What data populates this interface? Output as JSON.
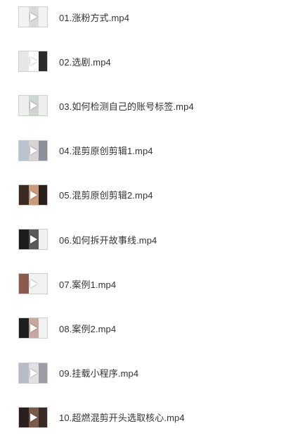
{
  "files": [
    {
      "name": "01.涨粉方式.mp4",
      "thumb_icon": "video-thumbnail-icon",
      "colors": [
        "#f2f2f2",
        "#d9d9d9",
        "#f2f2f2"
      ]
    },
    {
      "name": "02.选剧.mp4",
      "thumb_icon": "video-thumbnail-icon",
      "colors": [
        "#e6e6e6",
        "#ffffff",
        "#2b2b2b"
      ]
    },
    {
      "name": "03.如何检测自己的账号标签.mp4",
      "thumb_icon": "video-thumbnail-icon",
      "colors": [
        "#eeeeee",
        "#cfd6cf",
        "#eeeeee"
      ]
    },
    {
      "name": "04.混剪原创剪辑1.mp4",
      "thumb_icon": "video-thumbnail-icon",
      "colors": [
        "#b9c2cf",
        "#d8d2d5",
        "#8c8f99"
      ]
    },
    {
      "name": "05.混剪原创剪辑2.mp4",
      "thumb_icon": "video-thumbnail-icon",
      "colors": [
        "#3a2a22",
        "#c99a7a",
        "#2a201b"
      ]
    },
    {
      "name": "06.如何拆开故事线.mp4",
      "thumb_icon": "video-thumbnail-icon",
      "colors": [
        "#1c1c1c",
        "#5a5a5a",
        "#f0f0f0"
      ]
    },
    {
      "name": "07.案例1.mp4",
      "thumb_icon": "video-thumbnail-icon",
      "colors": [
        "#8a5a4e",
        "#f1f1f1",
        "#f1f1f1"
      ]
    },
    {
      "name": "08.案例2.mp4",
      "thumb_icon": "video-thumbnail-icon",
      "colors": [
        "#1e1e1e",
        "#c7a8a0",
        "#f1f1f1"
      ]
    },
    {
      "name": "09.挂载小程序.mp4",
      "thumb_icon": "video-thumbnail-icon",
      "colors": [
        "#b8bcc7",
        "#e3e0e4",
        "#9a9ca6"
      ]
    },
    {
      "name": "10.超燃混剪开头选取核心.mp4",
      "thumb_icon": "video-thumbnail-icon",
      "colors": [
        "#2a1f1c",
        "#7a5a48",
        "#3a2a24"
      ]
    }
  ]
}
